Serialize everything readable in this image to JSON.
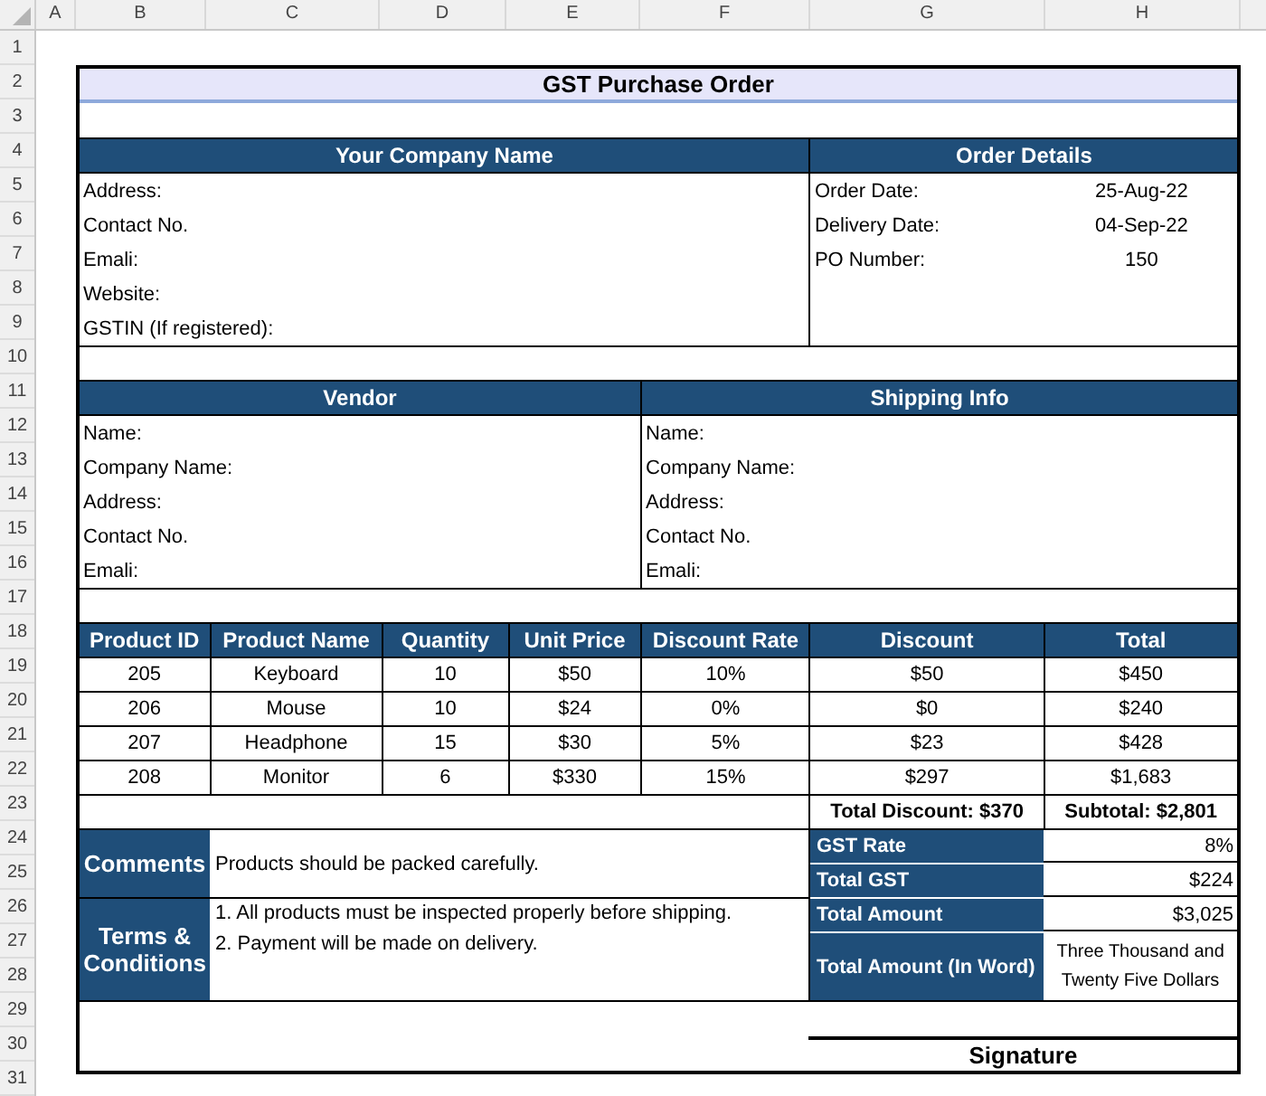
{
  "columns": [
    "A",
    "B",
    "C",
    "D",
    "E",
    "F",
    "G",
    "H"
  ],
  "row_numbers": [
    "1",
    "2",
    "3",
    "4",
    "5",
    "6",
    "7",
    "8",
    "9",
    "10",
    "11",
    "12",
    "13",
    "14",
    "15",
    "16",
    "17",
    "18",
    "19",
    "20",
    "21",
    "22",
    "23",
    "24",
    "25",
    "26",
    "27",
    "28",
    "29",
    "30",
    "31"
  ],
  "title": "GST Purchase Order",
  "company": {
    "heading": "Your Company Name",
    "fields": [
      "Address:",
      "Contact No.",
      "Emali:",
      "Website:",
      "GSTIN (If registered):"
    ]
  },
  "order_details": {
    "heading": "Order Details",
    "fields": [
      {
        "label": "Order Date:",
        "value": "25-Aug-22"
      },
      {
        "label": "Delivery Date:",
        "value": "04-Sep-22"
      },
      {
        "label": "PO Number:",
        "value": "150"
      }
    ]
  },
  "vendor": {
    "heading": "Vendor",
    "fields": [
      "Name:",
      "Company Name:",
      "Address:",
      "Contact No.",
      "Emali:"
    ]
  },
  "shipping": {
    "heading": "Shipping Info",
    "fields": [
      "Name:",
      "Company Name:",
      "Address:",
      "Contact No.",
      "Emali:"
    ]
  },
  "products": {
    "columns": [
      "Product ID",
      "Product Name",
      "Quantity",
      "Unit Price",
      "Discount Rate",
      "Discount",
      "Total"
    ],
    "rows": [
      [
        "205",
        "Keyboard",
        "10",
        "$50",
        "10%",
        "$50",
        "$450"
      ],
      [
        "206",
        "Mouse",
        "10",
        "$24",
        "0%",
        "$0",
        "$240"
      ],
      [
        "207",
        "Headphone",
        "15",
        "$30",
        "5%",
        "$23",
        "$428"
      ],
      [
        "208",
        "Monitor",
        "6",
        "$330",
        "15%",
        "$297",
        "$1,683"
      ]
    ]
  },
  "totals": {
    "total_discount": "Total Discount: $370",
    "subtotal": "Subtotal: $2,801"
  },
  "comments": {
    "label": "Comments",
    "text": "Products should be packed carefully."
  },
  "terms": {
    "label": "Terms & Conditions",
    "lines": [
      "1. All products must be inspected properly before shipping.",
      "2. Payment will be made on delivery."
    ]
  },
  "summary": [
    {
      "label": "GST Rate",
      "value": "8%"
    },
    {
      "label": "Total GST",
      "value": "$224"
    },
    {
      "label": "Total Amount",
      "value": "$3,025"
    },
    {
      "label": "Total Amount (In Word)",
      "value": "Three Thousand and Twenty Five Dollars"
    }
  ],
  "signature": "Signature"
}
